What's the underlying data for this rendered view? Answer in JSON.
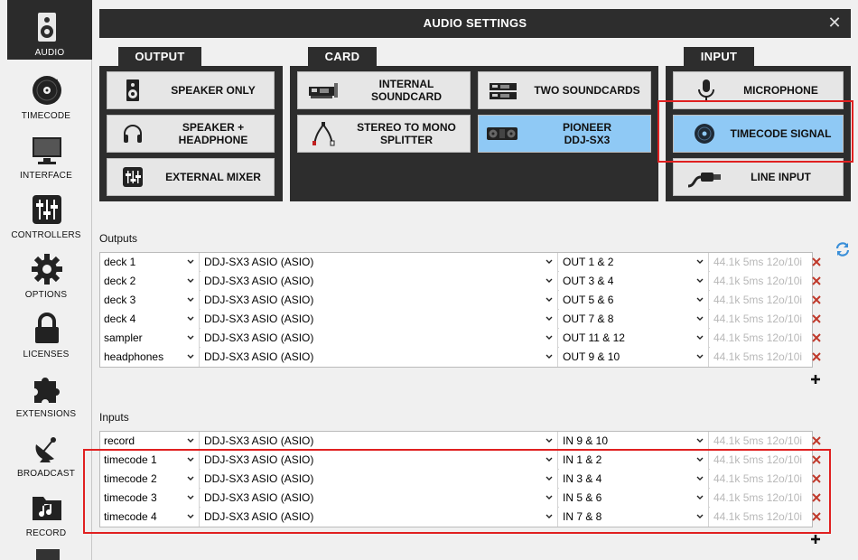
{
  "sidebar": {
    "items": [
      {
        "label": "AUDIO",
        "icon": "speaker-icon"
      },
      {
        "label": "TIMECODE",
        "icon": "vinyl-icon"
      },
      {
        "label": "INTERFACE",
        "icon": "monitor-icon"
      },
      {
        "label": "CONTROLLERS",
        "icon": "sliders-icon"
      },
      {
        "label": "OPTIONS",
        "icon": "gear-icon"
      },
      {
        "label": "LICENSES",
        "icon": "lock-icon"
      },
      {
        "label": "EXTENSIONS",
        "icon": "puzzle-icon"
      },
      {
        "label": "BROADCAST",
        "icon": "satellite-dish-icon"
      },
      {
        "label": "RECORD",
        "icon": "music-folder-icon"
      }
    ]
  },
  "window": {
    "title": "AUDIO SETTINGS",
    "close_label": "✕"
  },
  "output": {
    "tab": "OUTPUT",
    "buttons": [
      {
        "label": "SPEAKER ONLY",
        "icon": "speaker-icon"
      },
      {
        "label": "SPEAKER +\nHEADPHONE",
        "icon": "headphone-icon"
      },
      {
        "label": "EXTERNAL MIXER",
        "icon": "mixer-icon"
      }
    ]
  },
  "card": {
    "tab": "CARD",
    "buttons": [
      {
        "label": "INTERNAL\nSOUNDCARD",
        "icon": "soundcard-icon"
      },
      {
        "label": "TWO SOUNDCARDS",
        "icon": "soundcard-icon"
      },
      {
        "label": "STEREO TO MONO\nSPLITTER",
        "icon": "splitter-cable-icon"
      },
      {
        "label": "PIONEER\nDDJ-SX3",
        "icon": "controller-icon",
        "selected": true
      }
    ]
  },
  "input": {
    "tab": "INPUT",
    "buttons": [
      {
        "label": "MICROPHONE",
        "icon": "microphone-icon"
      },
      {
        "label": "TIMECODE SIGNAL",
        "icon": "timecode-icon",
        "selected": true
      },
      {
        "label": "LINE INPUT",
        "icon": "line-cable-icon"
      }
    ]
  },
  "outputs": {
    "label": "Outputs",
    "rows": [
      {
        "name": "deck 1",
        "device": "DDJ-SX3 ASIO (ASIO)",
        "channels": "OUT 1 & 2",
        "info": "44.1k 5ms 12o/10i"
      },
      {
        "name": "deck 2",
        "device": "DDJ-SX3 ASIO (ASIO)",
        "channels": "OUT 3 & 4",
        "info": "44.1k 5ms 12o/10i"
      },
      {
        "name": "deck 3",
        "device": "DDJ-SX3 ASIO (ASIO)",
        "channels": "OUT 5 & 6",
        "info": "44.1k 5ms 12o/10i"
      },
      {
        "name": "deck 4",
        "device": "DDJ-SX3 ASIO (ASIO)",
        "channels": "OUT 7 & 8",
        "info": "44.1k 5ms 12o/10i"
      },
      {
        "name": "sampler",
        "device": "DDJ-SX3 ASIO (ASIO)",
        "channels": "OUT 11 & 12",
        "info": "44.1k 5ms 12o/10i"
      },
      {
        "name": "headphones",
        "device": "DDJ-SX3 ASIO (ASIO)",
        "channels": "OUT 9 & 10",
        "info": "44.1k 5ms 12o/10i"
      }
    ]
  },
  "inputs": {
    "label": "Inputs",
    "rows": [
      {
        "name": "record",
        "device": "DDJ-SX3 ASIO (ASIO)",
        "channels": "IN 9 & 10",
        "info": "44.1k 5ms 12o/10i"
      },
      {
        "name": "timecode 1",
        "device": "DDJ-SX3 ASIO (ASIO)",
        "channels": "IN 1 & 2",
        "info": "44.1k 5ms 12o/10i"
      },
      {
        "name": "timecode 2",
        "device": "DDJ-SX3 ASIO (ASIO)",
        "channels": "IN 3 & 4",
        "info": "44.1k 5ms 12o/10i"
      },
      {
        "name": "timecode 3",
        "device": "DDJ-SX3 ASIO (ASIO)",
        "channels": "IN 5 & 6",
        "info": "44.1k 5ms 12o/10i"
      },
      {
        "name": "timecode 4",
        "device": "DDJ-SX3 ASIO (ASIO)",
        "channels": "IN 7 & 8",
        "info": "44.1k 5ms 12o/10i"
      }
    ]
  },
  "colors": {
    "dark_panel": "#2d2d2d",
    "selected": "#8fc9f5",
    "highlight": "#e02020",
    "delete": "#c0392b",
    "refresh": "#3a8fd8"
  }
}
